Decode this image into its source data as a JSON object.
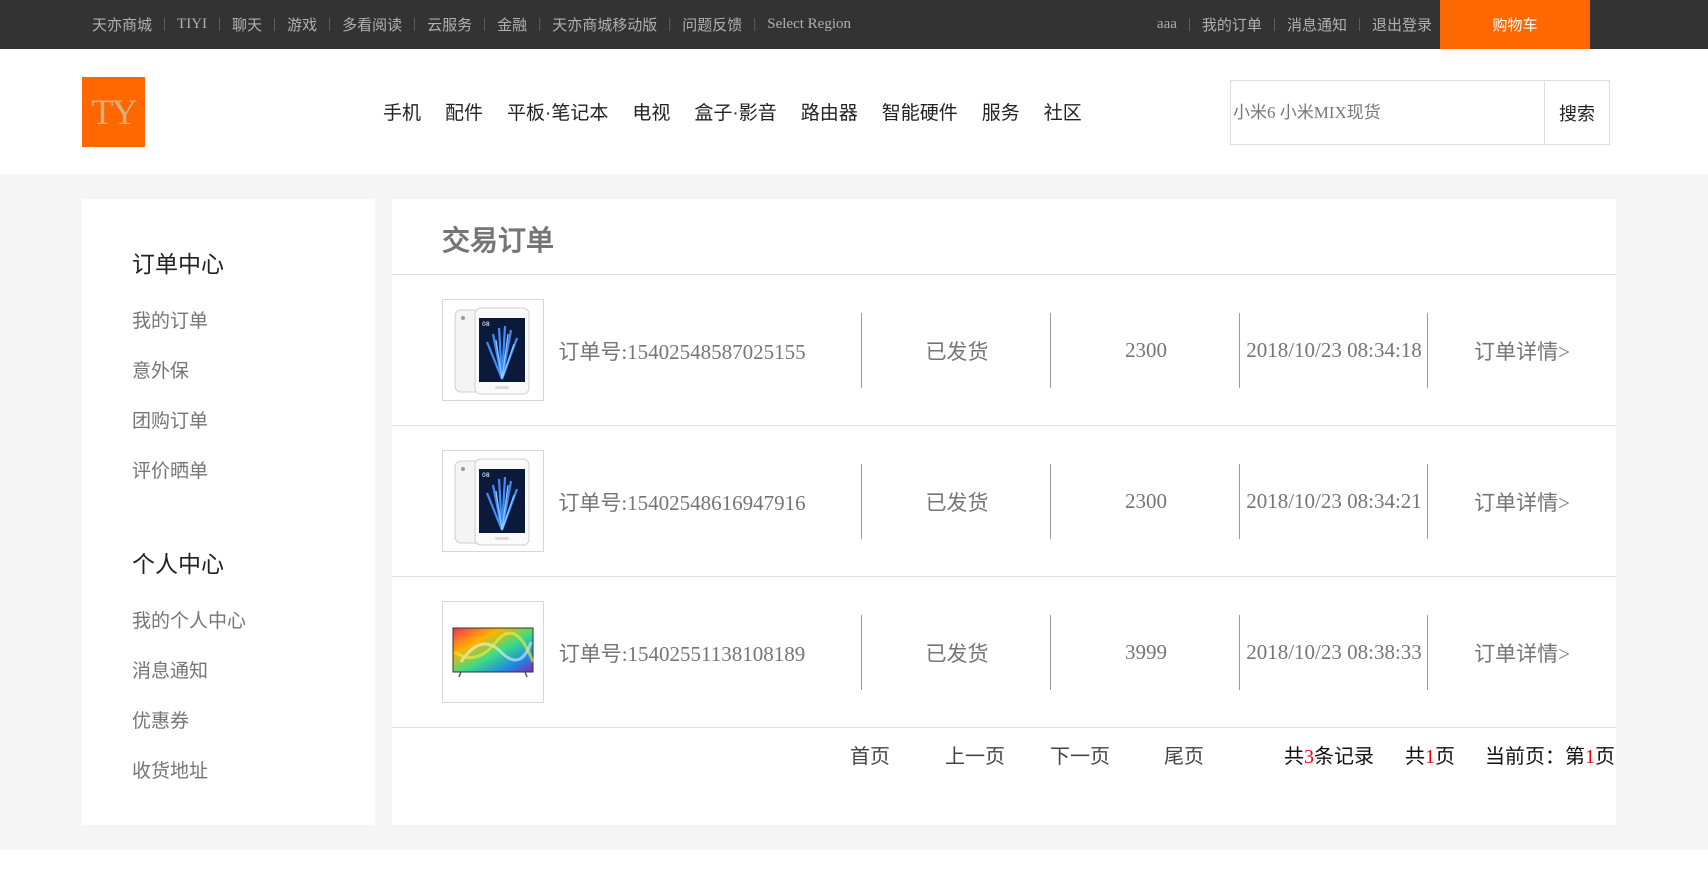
{
  "topbar": {
    "links": [
      "天亦商城",
      "TIYI",
      "聊天",
      "游戏",
      "多看阅读",
      "云服务",
      "金融",
      "天亦商城移动版",
      "问题反馈",
      "Select Region"
    ],
    "user": [
      "aaa",
      "我的订单",
      "消息通知",
      "退出登录"
    ],
    "cart_label": "购物车"
  },
  "header": {
    "logo_text": "TY",
    "nav": [
      "手机",
      "配件",
      "平板·笔记本",
      "电视",
      "盒子·影音",
      "路由器",
      "智能硬件",
      "服务",
      "社区"
    ],
    "search_placeholder": "小米6 小米MIX现货",
    "search_button": "搜索"
  },
  "sidebar": {
    "order_center": {
      "title": "订单中心",
      "items": [
        "我的订单",
        "意外保",
        "团购订单",
        "评价晒单"
      ]
    },
    "personal_center": {
      "title": "个人中心",
      "items": [
        "我的个人中心",
        "消息通知",
        "优惠券",
        "收货地址"
      ]
    }
  },
  "main": {
    "title": "交易订单",
    "orders": [
      {
        "order_no": "订单号:15402548587025155",
        "status": "已发货",
        "amount": "2300",
        "time": "2018/10/23 08:34:18",
        "detail": "订单详情>",
        "image": "phone-image"
      },
      {
        "order_no": "订单号:15402548616947916",
        "status": "已发货",
        "amount": "2300",
        "time": "2018/10/23 08:34:21",
        "detail": "订单详情>",
        "image": "phone-image"
      },
      {
        "order_no": "订单号:15402551138108189",
        "status": "已发货",
        "amount": "3999",
        "time": "2018/10/23 08:38:33",
        "detail": "订单详情>",
        "image": "tv-image"
      }
    ],
    "pager": {
      "first": "首页",
      "prev": "上一页",
      "next": "下一页",
      "last": "尾页",
      "total_prefix": "共",
      "total_count": "3",
      "total_suffix": "条记录",
      "pages_prefix": "共",
      "pages_count": "1",
      "pages_suffix": "页",
      "current_prefix": "当前页：第",
      "current_page": "1",
      "current_suffix": "页"
    }
  },
  "colors": {
    "accent": "#ff6700",
    "topbar_bg": "#333333",
    "page_bg": "#f5f5f5",
    "highlight": "#ff0000"
  }
}
